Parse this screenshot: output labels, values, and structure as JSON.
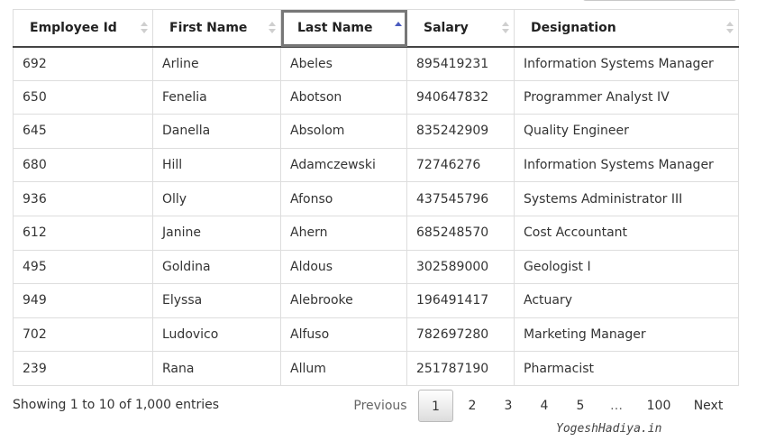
{
  "table": {
    "columns": [
      {
        "label": "Employee Id"
      },
      {
        "label": "First Name"
      },
      {
        "label": "Last Name",
        "sorted": "asc"
      },
      {
        "label": "Salary"
      },
      {
        "label": "Designation"
      }
    ],
    "rows": [
      [
        "692",
        "Arline",
        "Abeles",
        "895419231",
        "Information Systems Manager"
      ],
      [
        "650",
        "Fenelia",
        "Abotson",
        "940647832",
        "Programmer Analyst IV"
      ],
      [
        "645",
        "Danella",
        "Absolom",
        "835242909",
        "Quality Engineer"
      ],
      [
        "680",
        "Hill",
        "Adamczewski",
        "72746276",
        "Information Systems Manager"
      ],
      [
        "936",
        "Olly",
        "Afonso",
        "437545796",
        "Systems Administrator III"
      ],
      [
        "612",
        "Janine",
        "Ahern",
        "685248570",
        "Cost Accountant"
      ],
      [
        "495",
        "Goldina",
        "Aldous",
        "302589000",
        "Geologist I"
      ],
      [
        "949",
        "Elyssa",
        "Alebrooke",
        "196491417",
        "Actuary"
      ],
      [
        "702",
        "Ludovico",
        "Alfuso",
        "782697280",
        "Marketing Manager"
      ],
      [
        "239",
        "Rana",
        "Allum",
        "251787190",
        "Pharmacist"
      ]
    ]
  },
  "info": "Showing 1 to 10 of 1,000 entries",
  "pagination": {
    "previous": "Previous",
    "pages": [
      "1",
      "2",
      "3",
      "4",
      "5"
    ],
    "current": "1",
    "ellipsis": "…",
    "last": "100",
    "next": "Next"
  },
  "watermark": "YogeshHadiya.in",
  "colors": {
    "sort_active": "#4a5bbf",
    "header_border": "#444444"
  }
}
